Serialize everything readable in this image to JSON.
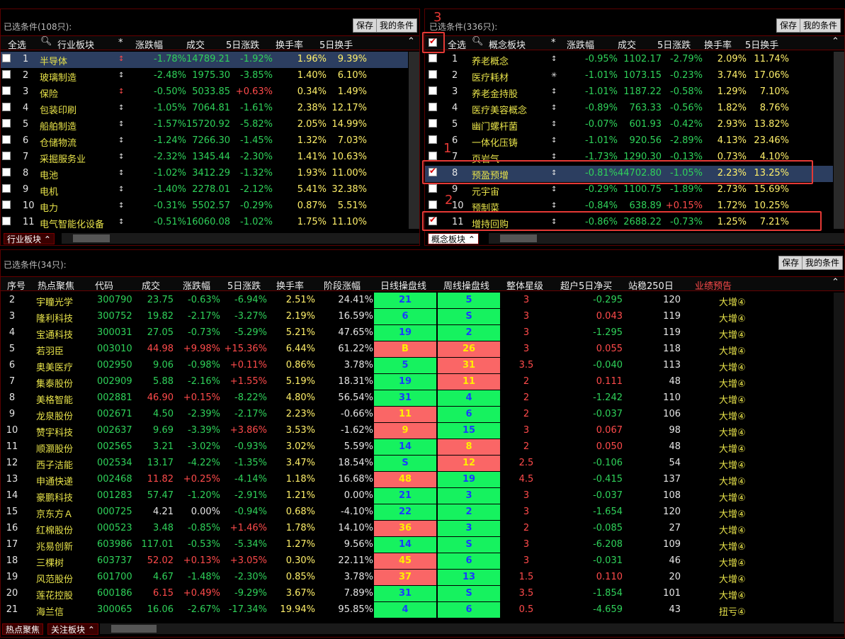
{
  "top_left": {
    "cond_label": "已选条件(108只):",
    "save": "保存",
    "my_cond": "我的条件",
    "headers": [
      "全选",
      "行业板块",
      "*",
      "涨跌幅",
      "成交",
      "5日涨跌",
      "换手率",
      "5日换手"
    ],
    "rows": [
      [
        "1",
        "半导体",
        "-1.78%",
        "14789.21",
        "-1.92%",
        "1.96%",
        "9.39%"
      ],
      [
        "2",
        "玻璃制造",
        "-2.48%",
        "1975.30",
        "-3.85%",
        "1.40%",
        "6.10%"
      ],
      [
        "3",
        "保险",
        "-0.50%",
        "5033.85",
        "+0.63%",
        "0.34%",
        "1.49%"
      ],
      [
        "4",
        "包装印刷",
        "-1.05%",
        "7064.81",
        "-1.61%",
        "2.38%",
        "12.17%"
      ],
      [
        "5",
        "船舶制造",
        "-1.57%",
        "15720.92",
        "-5.82%",
        "2.05%",
        "14.99%"
      ],
      [
        "6",
        "仓储物流",
        "-1.24%",
        "7266.30",
        "-1.45%",
        "1.32%",
        "7.03%"
      ],
      [
        "7",
        "采掘服务业",
        "-2.32%",
        "1345.44",
        "-2.30%",
        "1.41%",
        "10.63%"
      ],
      [
        "8",
        "电池",
        "-1.02%",
        "3412.29",
        "-1.32%",
        "1.93%",
        "11.00%"
      ],
      [
        "9",
        "电机",
        "-1.40%",
        "2278.01",
        "-2.12%",
        "5.41%",
        "32.38%"
      ],
      [
        "10",
        "电力",
        "-0.31%",
        "5502.57",
        "-0.29%",
        "0.87%",
        "5.51%"
      ],
      [
        "11",
        "电气智能化设备",
        "-0.51%",
        "16060.08",
        "-1.02%",
        "1.75%",
        "11.10%"
      ]
    ],
    "tab": "行业板块"
  },
  "top_right": {
    "cond_label": "已选条件(336只):",
    "save": "保存",
    "my_cond": "我的条件",
    "headers": [
      "全选",
      "概念板块",
      "*",
      "涨跌幅",
      "成交",
      "5日涨跌",
      "换手率",
      "5日换手"
    ],
    "rows": [
      [
        "1",
        "养老概念",
        "-0.95%",
        "1102.17",
        "-2.79%",
        "2.09%",
        "11.74%"
      ],
      [
        "2",
        "医疗耗材",
        "-1.01%",
        "1073.15",
        "-0.23%",
        "3.74%",
        "17.06%"
      ],
      [
        "3",
        "养老金持股",
        "-1.01%",
        "1187.22",
        "-0.58%",
        "1.29%",
        "7.10%"
      ],
      [
        "4",
        "医疗美容概念",
        "-0.89%",
        "763.33",
        "-0.56%",
        "1.82%",
        "8.76%"
      ],
      [
        "5",
        "幽门螺杆菌",
        "-0.07%",
        "601.93",
        "-0.42%",
        "2.93%",
        "13.82%"
      ],
      [
        "6",
        "一体化压铸",
        "-1.01%",
        "920.56",
        "-2.89%",
        "4.13%",
        "23.46%"
      ],
      [
        "7",
        "页岩气",
        "-1.73%",
        "1290.30",
        "-0.13%",
        "0.73%",
        "4.10%"
      ],
      [
        "8",
        "预盈预增",
        "-0.81%",
        "44702.80",
        "-1.05%",
        "2.23%",
        "13.25%"
      ],
      [
        "9",
        "元宇宙",
        "-0.29%",
        "1100.75",
        "-1.89%",
        "2.73%",
        "15.69%"
      ],
      [
        "10",
        "预制菜",
        "-0.84%",
        "638.89",
        "+0.15%",
        "1.72%",
        "10.25%"
      ],
      [
        "11",
        "增持回购",
        "-0.86%",
        "2688.22",
        "-0.73%",
        "1.25%",
        "7.21%"
      ]
    ],
    "tab": "概念板块",
    "annotations": [
      "1",
      "2",
      "3"
    ]
  },
  "bottom": {
    "cond_label": "已选条件(34只):",
    "save": "保存",
    "my_cond": "我的条件",
    "headers": [
      "序号",
      "热点聚焦",
      "代码",
      "成交",
      "涨跌幅",
      "5日涨跌",
      "换手率",
      "阶段涨幅",
      "日线操盘线",
      "周线操盘线",
      "整体星级",
      "超户5日净买",
      "站稳250日",
      "业绩预告"
    ],
    "rows": [
      [
        "2",
        "宇瞳光学",
        "300790",
        "23.75",
        "-0.63%",
        "-6.94%",
        "2.51%",
        "24.41%",
        "21",
        "5",
        "3",
        "-0.295",
        "120",
        "大增④"
      ],
      [
        "3",
        "隆利科技",
        "300752",
        "19.82",
        "-2.17%",
        "-3.27%",
        "2.19%",
        "16.59%",
        "6",
        "S",
        "3",
        "0.043",
        "119",
        "大增④"
      ],
      [
        "4",
        "宝通科技",
        "300031",
        "27.05",
        "-0.73%",
        "-5.29%",
        "5.21%",
        "47.65%",
        "19",
        "2",
        "3",
        "-1.295",
        "119",
        "大增④"
      ],
      [
        "5",
        "若羽臣",
        "003010",
        "44.98",
        "+9.98%",
        "+15.36%",
        "6.44%",
        "61.22%",
        "B",
        "26",
        "3",
        "0.055",
        "118",
        "大增④"
      ],
      [
        "6",
        "奥美医疗",
        "002950",
        "9.06",
        "-0.98%",
        "+0.11%",
        "0.86%",
        "3.78%",
        "5",
        "31",
        "3.5",
        "-0.040",
        "113",
        "大增④"
      ],
      [
        "7",
        "集泰股份",
        "002909",
        "5.88",
        "-2.16%",
        "+1.55%",
        "5.19%",
        "18.31%",
        "19",
        "11",
        "2",
        "0.111",
        "48",
        "大增④"
      ],
      [
        "8",
        "美格智能",
        "002881",
        "46.90",
        "+0.15%",
        "-8.22%",
        "4.80%",
        "56.54%",
        "31",
        "4",
        "2",
        "-1.242",
        "110",
        "大增④"
      ],
      [
        "9",
        "龙泉股份",
        "002671",
        "4.50",
        "-2.39%",
        "-2.17%",
        "2.23%",
        "-0.66%",
        "11",
        "6",
        "2",
        "-0.037",
        "106",
        "大增④"
      ],
      [
        "10",
        "赞宇科技",
        "002637",
        "9.69",
        "-3.39%",
        "+3.86%",
        "3.53%",
        "-1.62%",
        "9",
        "15",
        "3",
        "0.067",
        "98",
        "大增④"
      ],
      [
        "11",
        "顺灏股份",
        "002565",
        "3.21",
        "-3.02%",
        "-0.93%",
        "3.02%",
        "5.59%",
        "14",
        "8",
        "2",
        "0.050",
        "48",
        "大增④"
      ],
      [
        "12",
        "西子洁能",
        "002534",
        "13.17",
        "-4.22%",
        "-1.35%",
        "3.47%",
        "18.54%",
        "S",
        "12",
        "2.5",
        "-0.106",
        "54",
        "大增④"
      ],
      [
        "13",
        "申通快递",
        "002468",
        "11.82",
        "+0.25%",
        "-4.14%",
        "1.18%",
        "16.68%",
        "48",
        "19",
        "4.5",
        "-0.415",
        "137",
        "大增④"
      ],
      [
        "14",
        "豪鹏科技",
        "001283",
        "57.47",
        "-1.20%",
        "-2.91%",
        "1.21%",
        "0.00%",
        "21",
        "3",
        "3",
        "-0.037",
        "108",
        "大增④"
      ],
      [
        "15",
        "京东方Ａ",
        "000725",
        "4.21",
        "0.00%",
        "-0.94%",
        "0.68%",
        "-4.10%",
        "22",
        "2",
        "3",
        "-1.654",
        "120",
        "大增④"
      ],
      [
        "16",
        "红棉股份",
        "000523",
        "3.48",
        "-0.85%",
        "+1.46%",
        "1.78%",
        "14.10%",
        "36",
        "3",
        "2",
        "-0.085",
        "27",
        "大增④"
      ],
      [
        "17",
        "兆易创新",
        "603986",
        "117.01",
        "-0.53%",
        "-5.34%",
        "1.27%",
        "9.56%",
        "14",
        "S",
        "3",
        "-6.208",
        "109",
        "大增④"
      ],
      [
        "18",
        "三棵树",
        "603737",
        "52.02",
        "+0.13%",
        "+3.05%",
        "0.30%",
        "22.11%",
        "45",
        "6",
        "3",
        "-0.031",
        "46",
        "大增④"
      ],
      [
        "19",
        "风范股份",
        "601700",
        "4.67",
        "-1.48%",
        "-2.30%",
        "0.85%",
        "3.78%",
        "37",
        "13",
        "1.5",
        "0.110",
        "20",
        "大增④"
      ],
      [
        "20",
        "莲花控股",
        "600186",
        "6.15",
        "+0.49%",
        "-9.29%",
        "3.67%",
        "7.89%",
        "31",
        "S",
        "3.5",
        "-1.854",
        "101",
        "大增④"
      ],
      [
        "21",
        "海兰信",
        "300065",
        "16.06",
        "-2.67%",
        "-17.34%",
        "19.94%",
        "95.85%",
        "4",
        "6",
        "0.5",
        "-4.659",
        "43",
        "扭亏④"
      ]
    ],
    "tabs": [
      "热点聚焦",
      "关注板块"
    ]
  },
  "colors": {
    "up": "#ff4b4b",
    "down": "#2fd25a",
    "name": "#e8e34a",
    "selected": "#2c3e60",
    "cell_green": "#16f25f",
    "cell_red": "#fa6666",
    "annotation": "#e53935"
  }
}
